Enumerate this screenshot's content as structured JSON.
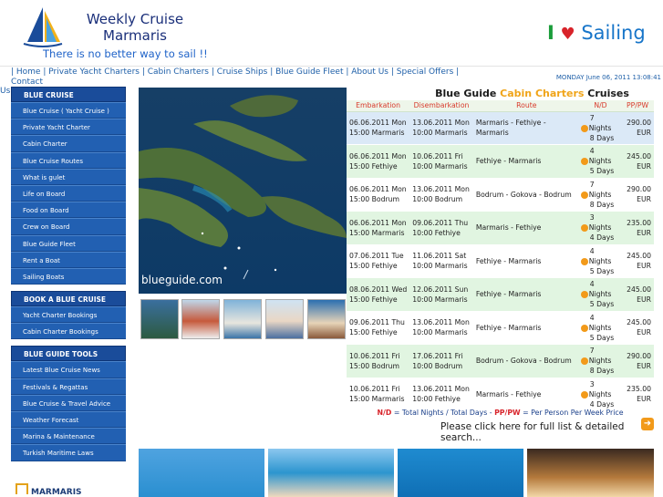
{
  "header": {
    "title_line1": "Weekly Cruise",
    "title_line2": "Marmaris",
    "tagline": "There is no better way to sail !!",
    "sailing_logo_i": "I",
    "sailing_logo_word": "Sailing"
  },
  "topnav": {
    "links": [
      "| Home |",
      "Private Yacht Charters |",
      "Cabin Charters |",
      "Cruise Ships |",
      "Blue Guide Fleet |",
      "About Us |",
      "Special Offers |",
      "Contact",
      "Us |"
    ],
    "date": "MONDAY June 06, 2011 13:08:41"
  },
  "sidebar": {
    "blocks": [
      {
        "head": "BLUE CRUISE",
        "items": [
          "Blue Cruise ( Yacht Cruise )",
          "Private Yacht Charter",
          "Cabin Charter",
          "Blue Cruise Routes",
          "What is gulet",
          "Life on Board",
          "Food on Board",
          "Crew on Board",
          "Blue Guide Fleet",
          "Rent a Boat",
          "Sailing Boats"
        ]
      },
      {
        "head": "BOOK A BLUE CRUISE",
        "items": [
          "Yacht Charter Bookings",
          "Cabin Charter Bookings"
        ]
      },
      {
        "head": "BLUE GUIDE TOOLS",
        "items": [
          "Latest Blue Cruise News",
          "Festivals & Regattas",
          "Blue Cruise & Travel Advice",
          "Weather Forecast",
          "Marina & Maintenance",
          "Turkish Maritime Laws"
        ]
      }
    ],
    "logo_text": "MARMARIS"
  },
  "hero": {
    "caption": "blueguide.com"
  },
  "cruises": {
    "title_prefix": "Blue Guide",
    "title_highlight": "Cabin Charters",
    "title_suffix": "Cruises",
    "columns": [
      "Embarkation",
      "Disembarkation",
      "Route",
      "N/D",
      "PP/PW"
    ],
    "rows": [
      {
        "emb1": "06.06.2011 Mon",
        "emb2": "15:00 Marmaris",
        "dis1": "13.06.2011 Mon",
        "dis2": "10:00 Marmaris",
        "route": "Marmaris - Fethiye - Marmaris",
        "n1": "7",
        "n2": "Nights",
        "n3": "8 Days",
        "price": "290.00 EUR"
      },
      {
        "emb1": "06.06.2011 Mon",
        "emb2": "15:00 Fethiye",
        "dis1": "10.06.2011 Fri",
        "dis2": "10:00 Marmaris",
        "route": "Fethiye - Marmaris",
        "n1": "4",
        "n2": "Nights",
        "n3": "5 Days",
        "price": "245.00 EUR"
      },
      {
        "emb1": "06.06.2011 Mon",
        "emb2": "15:00 Bodrum",
        "dis1": "13.06.2011 Mon",
        "dis2": "10:00 Bodrum",
        "route": "Bodrum - Gokova - Bodrum",
        "n1": "7",
        "n2": "Nights",
        "n3": "8 Days",
        "price": "290.00 EUR"
      },
      {
        "emb1": "06.06.2011 Mon",
        "emb2": "15:00 Marmaris",
        "dis1": "09.06.2011 Thu",
        "dis2": "10:00 Fethiye",
        "route": "Marmaris - Fethiye",
        "n1": "3",
        "n2": "Nights",
        "n3": "4 Days",
        "price": "235.00 EUR"
      },
      {
        "emb1": "07.06.2011 Tue",
        "emb2": "15:00 Fethiye",
        "dis1": "11.06.2011 Sat",
        "dis2": "10:00 Marmaris",
        "route": "Fethiye - Marmaris",
        "n1": "4",
        "n2": "Nights",
        "n3": "5 Days",
        "price": "245.00 EUR"
      },
      {
        "emb1": "08.06.2011 Wed",
        "emb2": "15:00 Fethiye",
        "dis1": "12.06.2011 Sun",
        "dis2": "10:00 Marmaris",
        "route": "Fethiye - Marmaris",
        "n1": "4",
        "n2": "Nights",
        "n3": "5 Days",
        "price": "245.00 EUR"
      },
      {
        "emb1": "09.06.2011 Thu",
        "emb2": "15:00 Fethiye",
        "dis1": "13.06.2011 Mon",
        "dis2": "10:00 Marmaris",
        "route": "Fethiye - Marmaris",
        "n1": "4",
        "n2": "Nights",
        "n3": "5 Days",
        "price": "245.00 EUR"
      },
      {
        "emb1": "10.06.2011 Fri",
        "emb2": "15:00 Bodrum",
        "dis1": "17.06.2011 Fri",
        "dis2": "10:00 Bodrum",
        "route": "Bodrum - Gokova - Bodrum",
        "n1": "7",
        "n2": "Nights",
        "n3": "8 Days",
        "price": "290.00 EUR"
      },
      {
        "emb1": "10.06.2011 Fri",
        "emb2": "15:00 Marmaris",
        "dis1": "13.06.2011 Mon",
        "dis2": "10:00 Fethiye",
        "route": "Marmaris - Fethiye",
        "n1": "3",
        "n2": "Nights",
        "n3": "4 Days",
        "price": "235.00 EUR"
      }
    ],
    "legend_nd": "N/D",
    "legend_nd_text": "= Total Nights / Total Days -",
    "legend_pp": "PP/PW",
    "legend_pp_text": "= Per Person Per Week Price",
    "more_text": "Please click here for full list & detailed search..."
  },
  "colors": {
    "nav_blue": "#2260b2",
    "accent_orange": "#f29a1a",
    "header_red": "#d83a2b"
  }
}
